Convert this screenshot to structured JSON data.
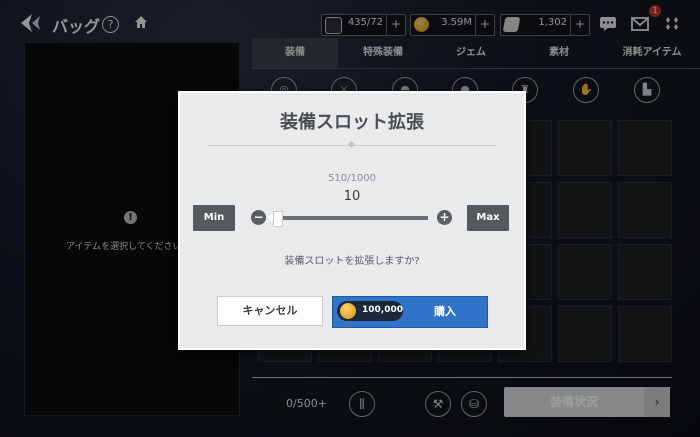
{
  "header": {
    "title": "バッグ",
    "help_symbol": "?",
    "resources": [
      {
        "icon": "stamina-icon",
        "value": "435/72",
        "plus": "+"
      },
      {
        "icon": "gold-coin-icon",
        "value": "3.59M",
        "plus": "+"
      },
      {
        "icon": "ticket-icon",
        "value": "1,302",
        "plus": "+"
      }
    ],
    "notification_count": "1"
  },
  "left_panel": {
    "message": "アイテムを選択してください"
  },
  "tabs": [
    "装備",
    "特殊装備",
    "ジェム",
    "素材",
    "消耗アイテム"
  ],
  "active_tab": "装備",
  "categories": [
    "weapon-icon",
    "sword-icon",
    "helmet-icon",
    "armor-icon",
    "shirt-icon",
    "gloves-icon",
    "boots-icon"
  ],
  "bottom": {
    "count": "0/500",
    "count_plus": "+",
    "status_button": "装備状況",
    "arrow": "›"
  },
  "dialog": {
    "title": "装備スロット拡張",
    "fraction": "510/1000",
    "quantity": "10",
    "min_label": "Min",
    "max_label": "Max",
    "minus": "−",
    "plus": "+",
    "slider_value": 0.01,
    "question": "装備スロットを拡張しますか?",
    "cancel": "キャンセル",
    "price": "100,000",
    "buy": "購入"
  },
  "colors": {
    "buy_button": "#2f74c8",
    "dialog_bg": "#e9eaec",
    "slider_buttons": "#55595f",
    "badge": "#c0352c",
    "coin": "#e0a220"
  }
}
